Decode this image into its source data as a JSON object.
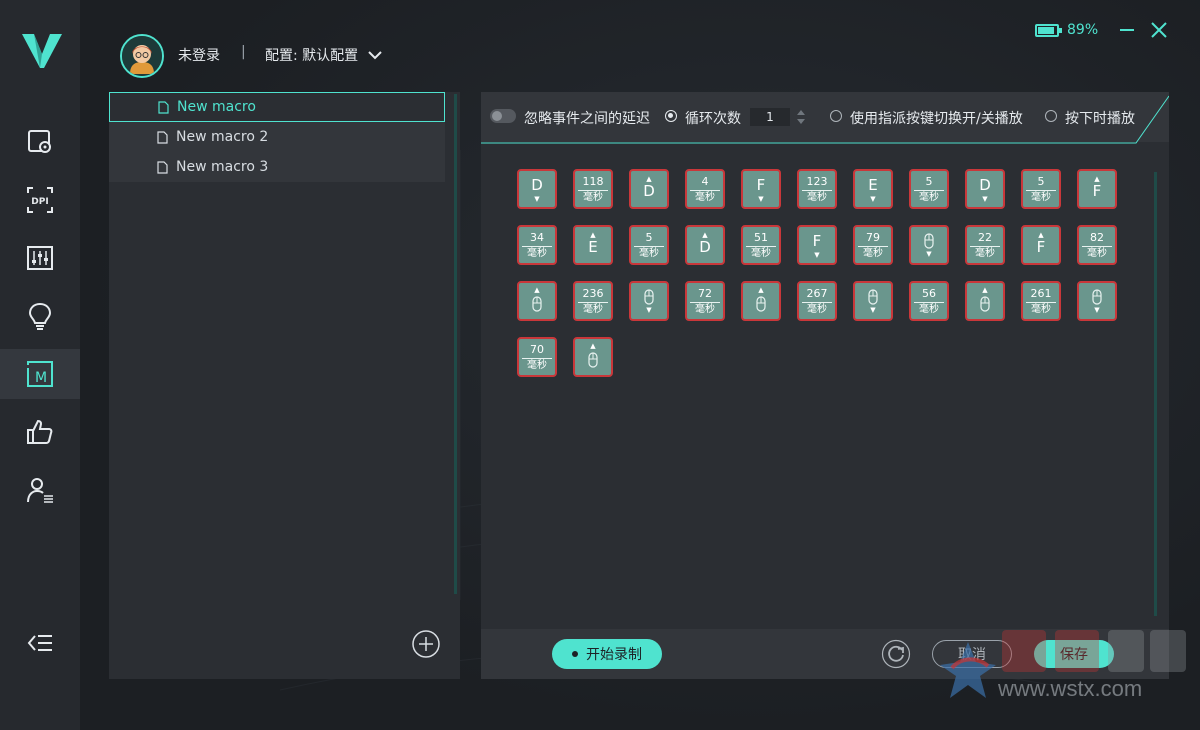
{
  "header": {
    "login_status": "未登录",
    "separator": "|",
    "profile_label": "配置: 默认配置",
    "battery_percent": "89%",
    "battery_level": 0.89
  },
  "sidebar": {
    "items": [
      {
        "icon": "device-settings-icon"
      },
      {
        "icon": "dpi-icon",
        "label": "DPI"
      },
      {
        "icon": "sliders-icon"
      },
      {
        "icon": "lightbulb-icon"
      },
      {
        "icon": "macro-icon",
        "label": "M",
        "active": true
      },
      {
        "icon": "thumbs-up-icon"
      },
      {
        "icon": "user-list-icon"
      }
    ],
    "collapse_icon": "collapse-menu-icon"
  },
  "macros": {
    "items": [
      {
        "name": "New macro",
        "selected": true
      },
      {
        "name": "New macro 2",
        "selected": false
      },
      {
        "name": "New macro 3",
        "selected": false
      }
    ]
  },
  "toolbar": {
    "ignore_delay_label": "忽略事件之间的延迟",
    "loop_count_label": "循环次数",
    "loop_count_value": "1",
    "toggle_key_label": "使用指派按键切换开/关播放",
    "hold_play_label": "按下时播放"
  },
  "events": {
    "unit": "毫秒",
    "rows": [
      [
        {
          "type": "key",
          "label": "D",
          "dir": "down"
        },
        {
          "type": "delay",
          "value": "118"
        },
        {
          "type": "key",
          "label": "D",
          "dir": "up"
        },
        {
          "type": "delay",
          "value": "4"
        },
        {
          "type": "key",
          "label": "F",
          "dir": "down"
        },
        {
          "type": "delay",
          "value": "123"
        },
        {
          "type": "key",
          "label": "E",
          "dir": "down"
        },
        {
          "type": "delay",
          "value": "5"
        },
        {
          "type": "key",
          "label": "D",
          "dir": "down"
        },
        {
          "type": "delay",
          "value": "5"
        },
        {
          "type": "key",
          "label": "F",
          "dir": "up"
        }
      ],
      [
        {
          "type": "delay",
          "value": "34"
        },
        {
          "type": "key",
          "label": "E",
          "dir": "up"
        },
        {
          "type": "delay",
          "value": "5"
        },
        {
          "type": "key",
          "label": "D",
          "dir": "up"
        },
        {
          "type": "delay",
          "value": "51"
        },
        {
          "type": "key",
          "label": "F",
          "dir": "down"
        },
        {
          "type": "delay",
          "value": "79"
        },
        {
          "type": "mouse",
          "dir": "down"
        },
        {
          "type": "delay",
          "value": "22"
        },
        {
          "type": "key",
          "label": "F",
          "dir": "up"
        },
        {
          "type": "delay",
          "value": "82"
        }
      ],
      [
        {
          "type": "mouse",
          "dir": "up"
        },
        {
          "type": "delay",
          "value": "236"
        },
        {
          "type": "mouse",
          "dir": "down"
        },
        {
          "type": "delay",
          "value": "72"
        },
        {
          "type": "mouse",
          "dir": "up"
        },
        {
          "type": "delay",
          "value": "267"
        },
        {
          "type": "mouse",
          "dir": "down"
        },
        {
          "type": "delay",
          "value": "56"
        },
        {
          "type": "mouse",
          "dir": "up"
        },
        {
          "type": "delay",
          "value": "261"
        },
        {
          "type": "mouse",
          "dir": "down"
        }
      ],
      [
        {
          "type": "delay",
          "value": "70"
        },
        {
          "type": "mouse",
          "dir": "up"
        }
      ]
    ]
  },
  "footer": {
    "record_label": "开始录制",
    "cancel_label": "取消",
    "save_label": "保存"
  },
  "watermark": {
    "text": "www.wstx.com"
  },
  "colors": {
    "accent": "#4fe3cf",
    "event_fill": "#6a968d",
    "event_border": "#c9373a"
  }
}
